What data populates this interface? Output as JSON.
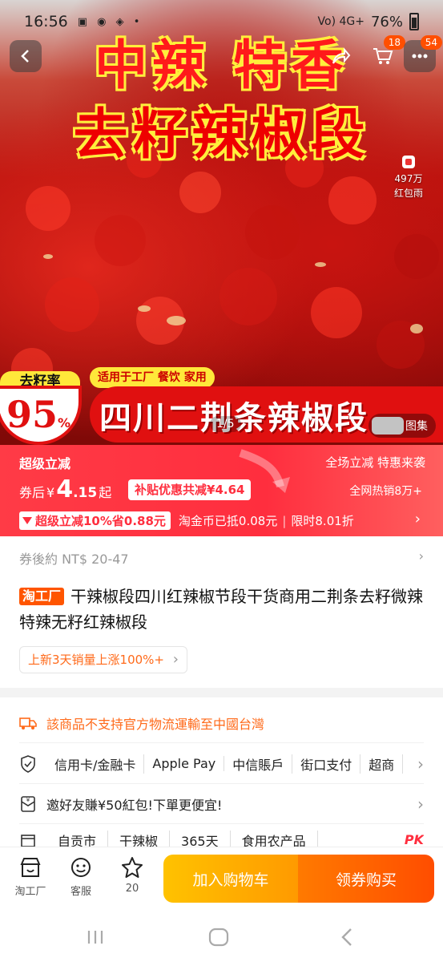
{
  "status_bar": {
    "time": "16:56",
    "left_icons": "▣ ◉ ◈ •",
    "network": "Vo) 4G+",
    "battery": "76%"
  },
  "cart_badge": "18",
  "more_badge": "54",
  "hero": {
    "headline_1": "中辣  特香",
    "headline_2": "去籽辣椒段",
    "redpacket_count": "497万",
    "redpacket_label": "红包雨",
    "seed_rate_label": "去籽率",
    "seed_rate_value": "95",
    "seed_rate_unit": "%",
    "usage_tag": "适用于工厂 餐饮 家用",
    "strip_title": "四川二荆条辣椒段",
    "image_counter": "1/5",
    "gallery_label": "图集"
  },
  "price_banner": {
    "flash_label": "超级立减",
    "slogan": "全场立减 特惠来袭",
    "price_prefix": "券后",
    "currency": "¥",
    "price_int": "4",
    "price_dec": ".15",
    "price_suffix": "起",
    "subsidy": "补贴优惠共减¥4.64",
    "hot_sales": "全网热销8万+",
    "flash_chip": "超级立减10%省0.88元",
    "coin_note": "淘金币已抵0.08元",
    "limited_discount": "限时8.01折"
  },
  "coupon": {
    "text": "券後約 NT$ 20-47"
  },
  "product": {
    "brand_tag": "淘工厂",
    "title": "干辣椒段四川红辣椒节段干货商用二荆条去籽微辣特辣无籽红辣椒段",
    "trend": "上新3天销量上涨100%+"
  },
  "services": {
    "logistics": "該商品不支持官方物流運輸至中國台灣",
    "payments": [
      "信用卡/金融卡",
      "Apple Pay",
      "中信賬戶",
      "街口支付",
      "超商"
    ],
    "invite": "邀好友賺¥50紅包!下單更便宜!",
    "props": [
      "自贡市",
      "干辣椒",
      "365天",
      "食用农产品"
    ],
    "pk": "PK"
  },
  "bottom_bar": {
    "shop": "淘工厂",
    "service": "客服",
    "fav_count": "20",
    "add_to_cart": "加入购物车",
    "buy": "领券购买"
  },
  "colors": {
    "brand_red": "#ff2e3e",
    "orange": "#ff6a1a",
    "cart_yellow": "#ffc200",
    "buy_orange": "#ff4d00"
  }
}
